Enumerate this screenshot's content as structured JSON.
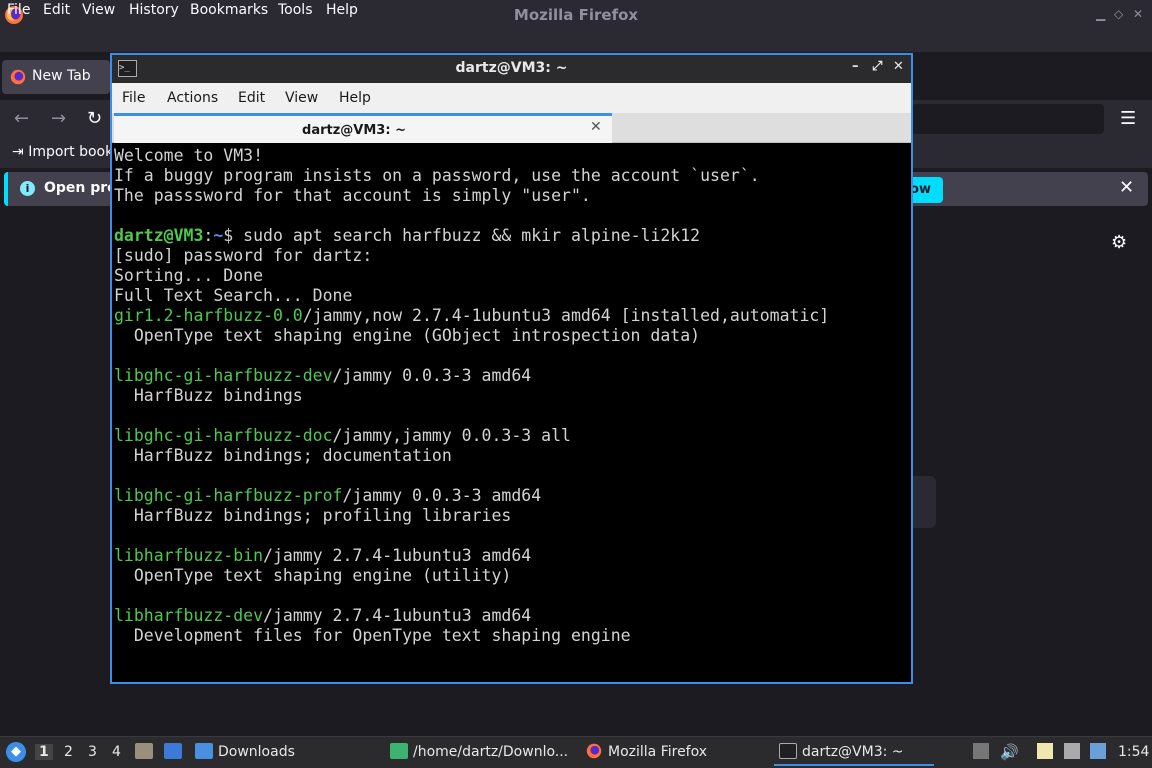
{
  "firefox": {
    "title": "Mozilla Firefox",
    "menu": [
      "File",
      "Edit",
      "View",
      "History",
      "Bookmarks",
      "Tools",
      "Help"
    ],
    "tab_label": "New Tab",
    "import_bookmarks": "Import book",
    "info_text": "Open pre",
    "info_button": "ow",
    "accent_color": "#00ddff"
  },
  "terminal": {
    "title": "dartz@VM3: ~",
    "menu": [
      "File",
      "Actions",
      "Edit",
      "View",
      "Help"
    ],
    "tab_label": "dartz@VM3: ~",
    "prompt": {
      "user": "dartz@VM3",
      "sep": ":",
      "path": "~",
      "symbol": "$ "
    },
    "command": "sudo apt search harfbuzz && mkir alpine-li2k12",
    "lines": [
      {
        "kind": "plain",
        "text": "Welcome to VM3!"
      },
      {
        "kind": "plain",
        "text": "If a buggy program insists on a password, use the account `user`."
      },
      {
        "kind": "plain",
        "text": "The passsword for that account is simply \"user\"."
      },
      {
        "kind": "blank",
        "text": ""
      },
      {
        "kind": "prompt",
        "text": ""
      },
      {
        "kind": "plain",
        "text": "[sudo] password for dartz:"
      },
      {
        "kind": "plain",
        "text": "Sorting... Done"
      },
      {
        "kind": "plain",
        "text": "Full Text Search... Done"
      },
      {
        "kind": "pkg",
        "pkg": "gir1.2-harfbuzz-0.0",
        "text": "/jammy,now 2.7.4-1ubuntu3 amd64 [installed,automatic]"
      },
      {
        "kind": "plain",
        "text": "  OpenType text shaping engine (GObject introspection data)"
      },
      {
        "kind": "blank",
        "text": ""
      },
      {
        "kind": "pkg",
        "pkg": "libghc-gi-harfbuzz-dev",
        "text": "/jammy 0.0.3-3 amd64"
      },
      {
        "kind": "plain",
        "text": "  HarfBuzz bindings"
      },
      {
        "kind": "blank",
        "text": ""
      },
      {
        "kind": "pkg",
        "pkg": "libghc-gi-harfbuzz-doc",
        "text": "/jammy,jammy 0.0.3-3 all"
      },
      {
        "kind": "plain",
        "text": "  HarfBuzz bindings; documentation"
      },
      {
        "kind": "blank",
        "text": ""
      },
      {
        "kind": "pkg",
        "pkg": "libghc-gi-harfbuzz-prof",
        "text": "/jammy 0.0.3-3 amd64"
      },
      {
        "kind": "plain",
        "text": "  HarfBuzz bindings; profiling libraries"
      },
      {
        "kind": "blank",
        "text": ""
      },
      {
        "kind": "pkg",
        "pkg": "libharfbuzz-bin",
        "text": "/jammy 2.7.4-1ubuntu3 amd64"
      },
      {
        "kind": "plain",
        "text": "  OpenType text shaping engine (utility)"
      },
      {
        "kind": "blank",
        "text": ""
      },
      {
        "kind": "pkg",
        "pkg": "libharfbuzz-dev",
        "text": "/jammy 2.7.4-1ubuntu3 amd64"
      },
      {
        "kind": "plain",
        "text": "  Development files for OpenType text shaping engine"
      }
    ],
    "colors": {
      "package": "#4ec94e",
      "user": "#4ec94e",
      "path": "#4f8fe8",
      "accent": "#3d8ee8"
    }
  },
  "taskbar": {
    "workspaces": [
      "1",
      "2",
      "3",
      "4"
    ],
    "tasks": [
      {
        "label": "Downloads",
        "icon": "folder-icon"
      },
      {
        "label": "/home/dartz/Downlo...",
        "icon": "image-viewer-icon"
      },
      {
        "label": "Mozilla Firefox",
        "icon": "firefox-icon"
      },
      {
        "label": "dartz@VM3: ~",
        "icon": "terminal-icon"
      }
    ],
    "clock": "1:54"
  }
}
